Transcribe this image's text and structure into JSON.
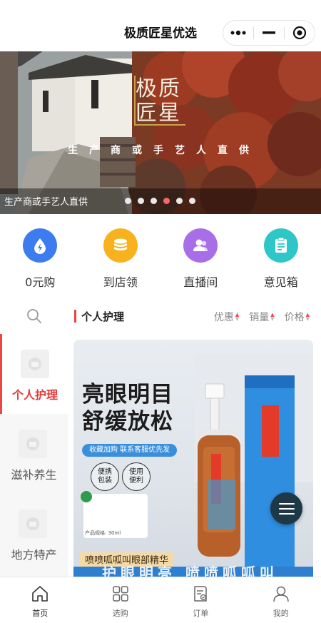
{
  "header": {
    "title": "极质匠星优选"
  },
  "banner": {
    "logo_line1": "极质",
    "logo_line2": "匠星",
    "slogan": "生产商或手艺人直供",
    "caption": "生产商或手艺人直供",
    "slide_count": 6,
    "active_slide": 4
  },
  "quick_nav": [
    {
      "label": "0元购",
      "icon": "water-drop-icon",
      "color": "#3d7cf0"
    },
    {
      "label": "到店领",
      "icon": "coin-stack-icon",
      "color": "#f7b21e"
    },
    {
      "label": "直播间",
      "icon": "user-group-icon",
      "color": "#a86ee8"
    },
    {
      "label": "意见箱",
      "icon": "clipboard-icon",
      "color": "#2ec6c6"
    }
  ],
  "categories": [
    {
      "label": "个人护理",
      "active": true
    },
    {
      "label": "滋补养生",
      "active": false
    },
    {
      "label": "地方特产",
      "active": false
    }
  ],
  "list": {
    "title": "个人护理",
    "sorts": [
      "优惠",
      "销量",
      "价格"
    ]
  },
  "product": {
    "headline1": "亮眼明目",
    "headline2": "舒缓放松",
    "pill": "收藏加购 联系客服优先发",
    "badge1": "便携\n包装",
    "badge2": "使用\n便利",
    "spec": "产品规格: 30ml",
    "name": "喷喷呱呱叫眼部精华",
    "bottom_text": "护眼明亮 喷喷呱呱叫",
    "bottle_label": "喷喷呱呱叫"
  },
  "tabbar": [
    {
      "label": "首页",
      "icon": "home-icon",
      "active": true
    },
    {
      "label": "选购",
      "icon": "grid-icon",
      "active": false
    },
    {
      "label": "订单",
      "icon": "order-icon",
      "active": false
    },
    {
      "label": "我的",
      "icon": "user-icon",
      "active": false
    }
  ]
}
